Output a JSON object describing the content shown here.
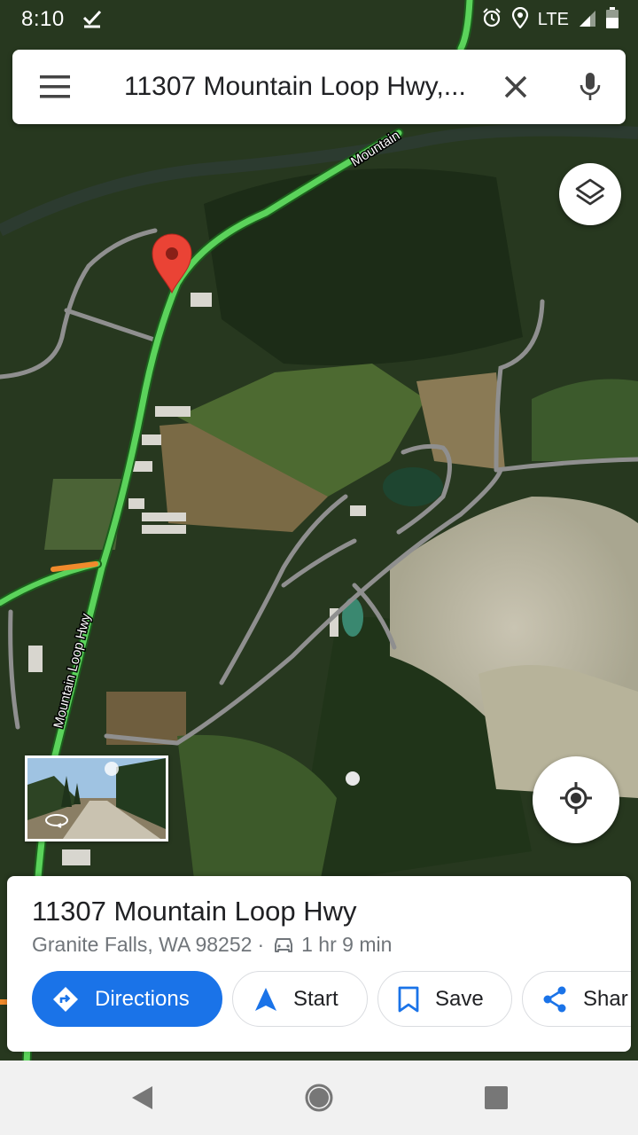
{
  "status_bar": {
    "time": "8:10",
    "network": "LTE",
    "icons": [
      "checkmark-icon",
      "alarm-icon",
      "location-icon",
      "signal-icon",
      "battery-icon"
    ]
  },
  "search": {
    "query": "11307 Mountain Loop Hwy,...",
    "icons": [
      "menu-icon",
      "close-icon",
      "mic-icon"
    ]
  },
  "map": {
    "road_labels": [
      "Mountain",
      "Mountain Loop Hwy"
    ],
    "type": "satellite",
    "pin_color": "#ea4335",
    "traffic_color": "#5bd35b"
  },
  "place": {
    "title": "11307 Mountain Loop Hwy",
    "address": "Granite Falls, WA 98252",
    "separator": "·",
    "drive_time": "1 hr 9 min"
  },
  "actions": {
    "directions": "Directions",
    "start": "Start",
    "save": "Save",
    "share": "Shar"
  },
  "colors": {
    "accent": "#1a73e8",
    "text_primary": "#202124",
    "text_secondary": "#70757a"
  },
  "nav_bar": {
    "icons": [
      "back-icon",
      "home-icon",
      "recents-icon"
    ]
  }
}
